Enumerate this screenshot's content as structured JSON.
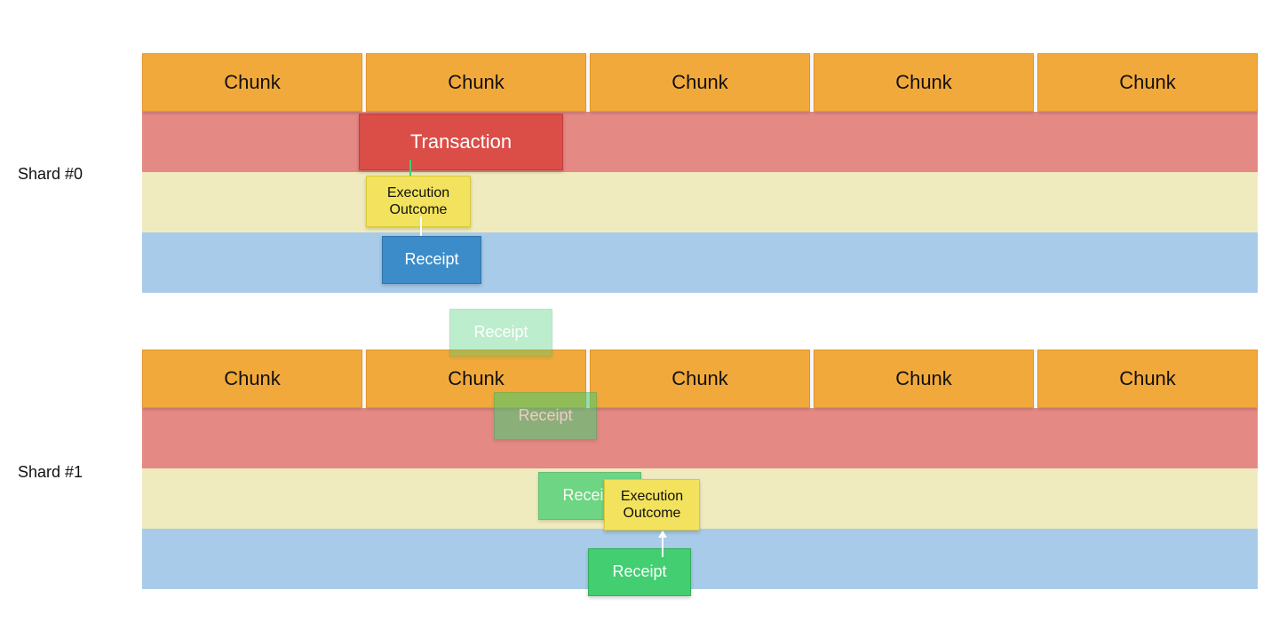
{
  "shards": [
    {
      "label": "Shard #0"
    },
    {
      "label": "Shard #1"
    }
  ],
  "chunk_label": "Chunk",
  "transaction_label": "Transaction",
  "execution_outcome_label": "Execution\nOutcome",
  "receipt_label": "Receipt",
  "colors": {
    "chunk_bg": "#f2a93b",
    "band_red": "#e58984",
    "band_cream": "#f0ebbf",
    "band_blue": "#a8cbe9",
    "transaction": "#db4d47",
    "exec_outcome": "#f2e25d",
    "receipt_blue": "#3c8cc9",
    "receipt_green": "#42ce71"
  },
  "diagram": {
    "description": "Two shards each containing a row of 5 Chunk headers above three colored bands (red, cream, blue). A Transaction in Shard #0's red band produces an Execution Outcome (cream band) and a Receipt (blue band). The Receipt propagates (shown as fading green Receipt boxes stepping diagonally) down into Shard #1 where it yields an Execution Outcome and a final Receipt.",
    "chunks_per_shard": 5,
    "receipt_propagation_steps": 4
  }
}
